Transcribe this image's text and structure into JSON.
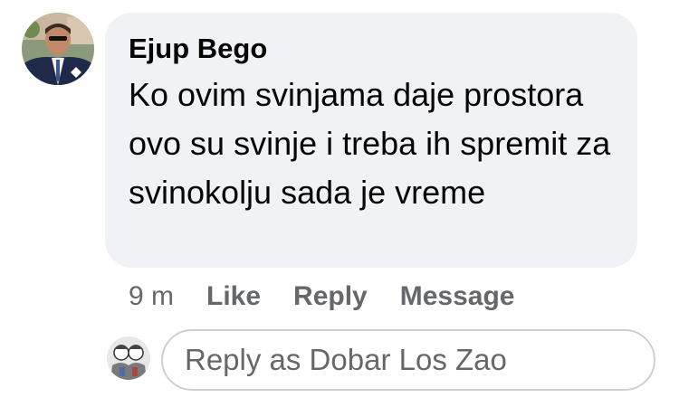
{
  "comment": {
    "author": "Ejup Bego",
    "text": "Ko ovim svinjama daje prostora ovo su svinje i treba ih spremit za svinokolju sada je vreme",
    "time": "9 m",
    "actions": {
      "like": "Like",
      "reply": "Reply",
      "message": "Message"
    }
  },
  "reply": {
    "placeholder": "Reply as Dobar Los Zao"
  },
  "colors": {
    "bubble_bg": "#f0f2f5",
    "text": "#050505",
    "secondary_text": "#65676b",
    "border": "#ccd0d5"
  }
}
